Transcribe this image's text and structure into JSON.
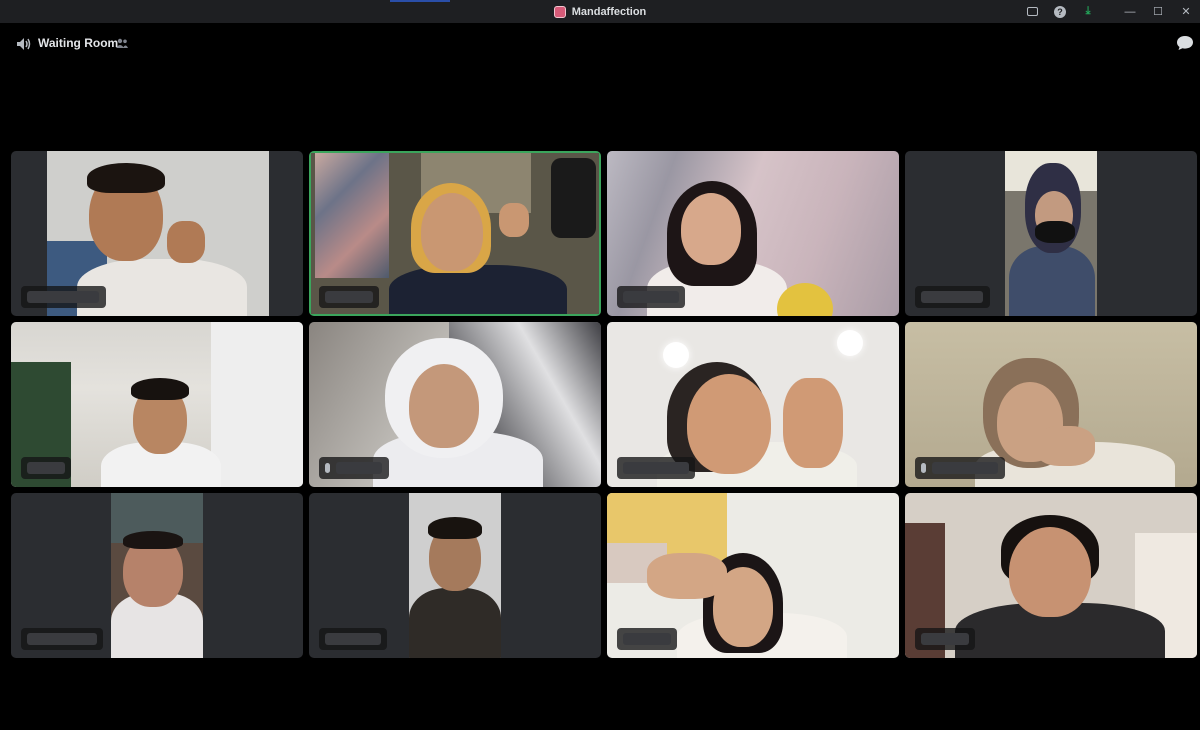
{
  "window": {
    "title": "Mandaffection",
    "controls": [
      "inbox-icon",
      "help-icon",
      "download-icon",
      "minimize-icon",
      "maximize-icon",
      "close-icon"
    ],
    "help_glyph": "?",
    "download_glyph": "⤓",
    "minimize_glyph": "—",
    "maximize_glyph": "☐",
    "close_glyph": "✕"
  },
  "header": {
    "room_name": "Waiting Room",
    "icons": [
      "speaker-icon",
      "people-icon",
      "chat-icon"
    ]
  },
  "colors": {
    "background": "#000000",
    "titlebar": "#1e1f22",
    "tile": "#2b2d31",
    "speaking_border": "#3ba55c",
    "download": "#23a55a"
  },
  "participants": [
    {
      "id": "p1",
      "speaking": false
    },
    {
      "id": "p2",
      "speaking": true
    },
    {
      "id": "p3",
      "speaking": false
    },
    {
      "id": "p4",
      "speaking": false
    },
    {
      "id": "p5",
      "speaking": false
    },
    {
      "id": "p6",
      "speaking": false
    },
    {
      "id": "p7",
      "speaking": false
    },
    {
      "id": "p8",
      "speaking": false
    },
    {
      "id": "p9",
      "speaking": false
    },
    {
      "id": "p10",
      "speaking": false
    },
    {
      "id": "p11",
      "speaking": false
    },
    {
      "id": "p12",
      "speaking": false
    }
  ]
}
